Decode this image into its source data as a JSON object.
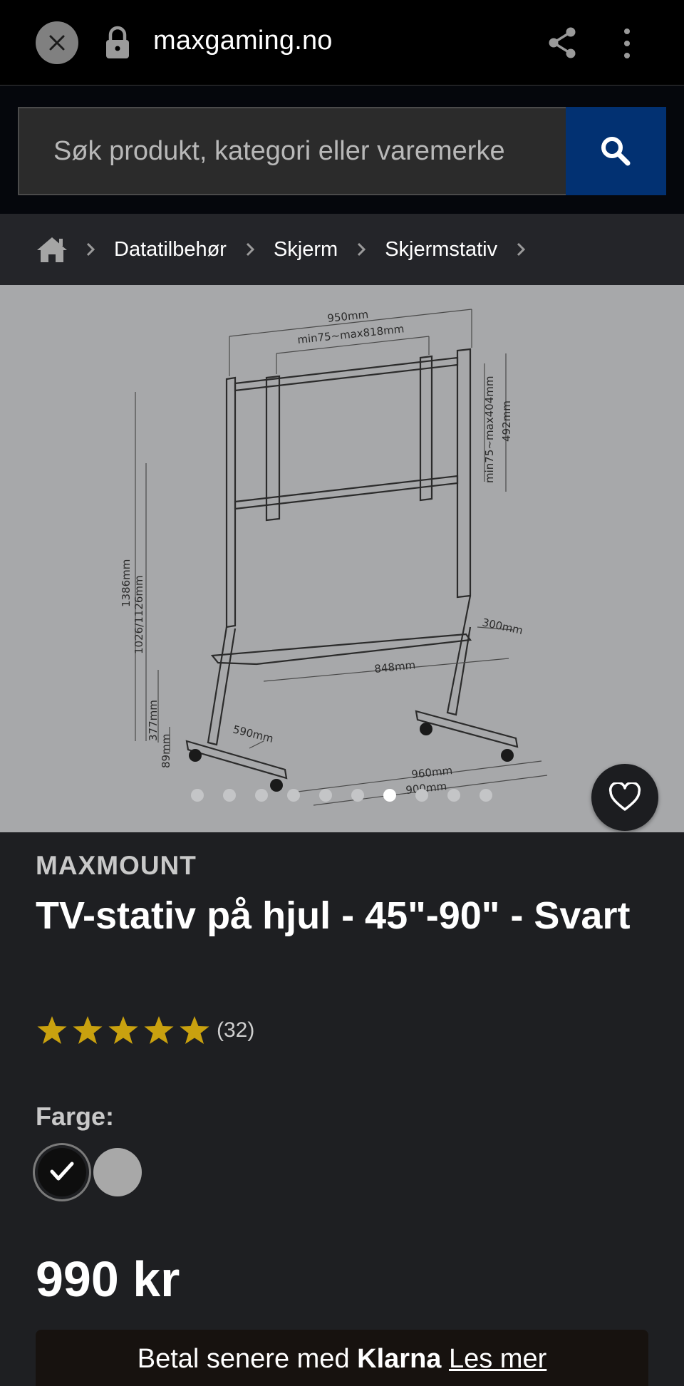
{
  "browser": {
    "url": "maxgaming.no",
    "icons": [
      "close-icon",
      "lock-icon",
      "share-icon",
      "more-vert-icon"
    ]
  },
  "search": {
    "placeholder": "Søk produkt, kategori eller varemerke",
    "button_icon": "search-icon",
    "button_color": "#023172"
  },
  "breadcrumb": {
    "home_icon": "home-icon",
    "items": [
      "Datatilbehør",
      "Skjerm",
      "Skjermstativ"
    ]
  },
  "image": {
    "dimension_labels": [
      "950mm",
      "min75~max818mm",
      "min75~max404mm",
      "492mm",
      "1386mm",
      "1026/1126mm",
      "300mm",
      "848mm",
      "377mm",
      "590mm",
      "89mm",
      "960mm",
      "900mm"
    ],
    "carousel": {
      "count": 10,
      "active_index": 6
    },
    "favorite_icon": "heart-icon"
  },
  "product": {
    "brand": "MAXMOUNT",
    "title": "TV-stativ på hjul - 45\"-90\" - Svart",
    "rating": {
      "stars": 5,
      "max": 5,
      "count_label": "(32)",
      "star_color": "#c9a10f"
    },
    "color_label": "Farge:",
    "colors": [
      {
        "name": "black",
        "hex": "#0e0e0e",
        "selected": true
      },
      {
        "name": "grey",
        "hex": "#a8a8a8",
        "selected": false
      }
    ],
    "price": "990 kr"
  },
  "klarna": {
    "prefix": "Betal senere med ",
    "brand": "Klarna",
    "link": "Les mer"
  }
}
